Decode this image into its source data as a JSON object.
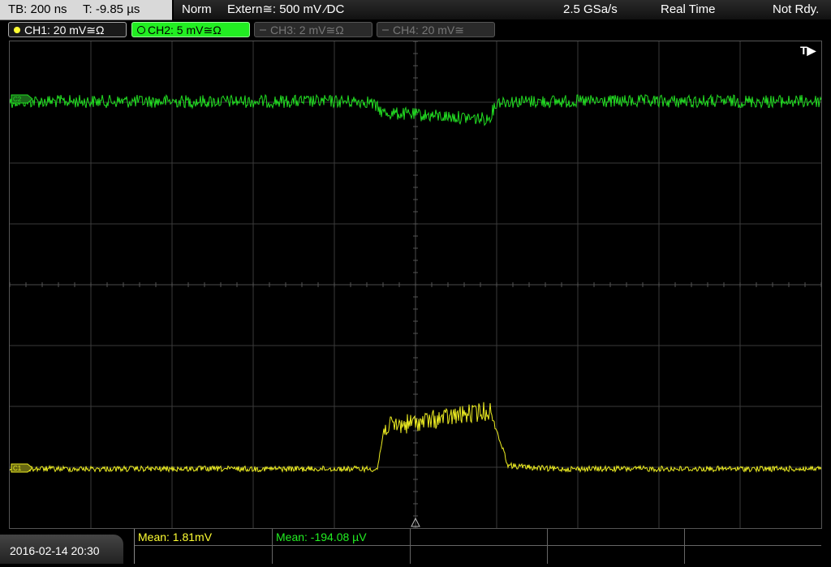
{
  "header": {
    "timebase": "TB: 200 ns",
    "trigger_time": "T: -9.85 µs",
    "mode": "Norm",
    "trigger_source": "Extern≅: 500 mV ⁄DC",
    "sample_rate": "2.5 GSa/s",
    "acq_mode": "Real Time",
    "status": "Not Rdy."
  },
  "channels": [
    {
      "label": "CH1: 20 mV≅Ω",
      "color": "#ffff33",
      "active": true
    },
    {
      "label": "CH2: 5 mV≅Ω",
      "color": "#22ee22",
      "active": true
    },
    {
      "label": "CH3: 2 mV≅Ω",
      "color": "#777777",
      "active": false
    },
    {
      "label": "CH4: 20 mV≅",
      "color": "#777777",
      "active": false
    }
  ],
  "plot": {
    "trigger_marker": "T▶",
    "ch2_marker": "C2",
    "ch1_marker": "C1"
  },
  "footer": {
    "datetime": "2016-02-14 20:30",
    "measurements": [
      {
        "label": "Mean: 1.81mV",
        "color": "#ffff33"
      },
      {
        "label": "Mean: -194.08 µV",
        "color": "#22ee22"
      }
    ]
  }
}
